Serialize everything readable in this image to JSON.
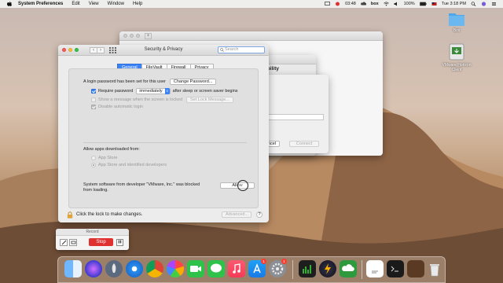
{
  "menubar": {
    "app_name": "System Preferences",
    "items": [
      "Edit",
      "View",
      "Window",
      "Help"
    ],
    "time": "03:48",
    "box_label": "box",
    "battery": "100%",
    "clock": "Tue 3:18 PM"
  },
  "desktop_icons": [
    {
      "label": "Box"
    },
    {
      "label": "VMware Horizon Client"
    }
  ],
  "security_window": {
    "title": "Security & Privacy",
    "search_placeholder": "Search",
    "tabs": [
      "General",
      "FileVault",
      "Firewall",
      "Privacy"
    ],
    "login_text": "A login password has been set for this user",
    "change_password_label": "Change Password...",
    "require_password_label": "Require password",
    "require_password_value": "immediately",
    "require_password_suffix": "after sleep or screen saver begins",
    "show_message_label": "Show a message when the screen is locked",
    "set_lock_message_label": "Set Lock Message...",
    "disable_autologin_label": "Disable automatic login",
    "allow_apps_label": "Allow apps downloaded from:",
    "app_store_label": "App Store",
    "app_store_identified_label": "App Store and identified developers",
    "blocked_text_1": "System software from developer \"VMware, Inc.\" was blocked",
    "blocked_text_2": "from loading.",
    "allow_label": "Allow",
    "lock_text": "Click the lock to make changes.",
    "advanced_label": "Advanced...",
    "help_label": "?"
  },
  "background_window": {
    "heading_partial": "ibility",
    "cancel_partial": "ncel",
    "connect_label": "Connect"
  },
  "record": {
    "title": "Record",
    "stop_label": "Stop"
  },
  "dock": {
    "badges": [
      "1",
      "1"
    ]
  }
}
